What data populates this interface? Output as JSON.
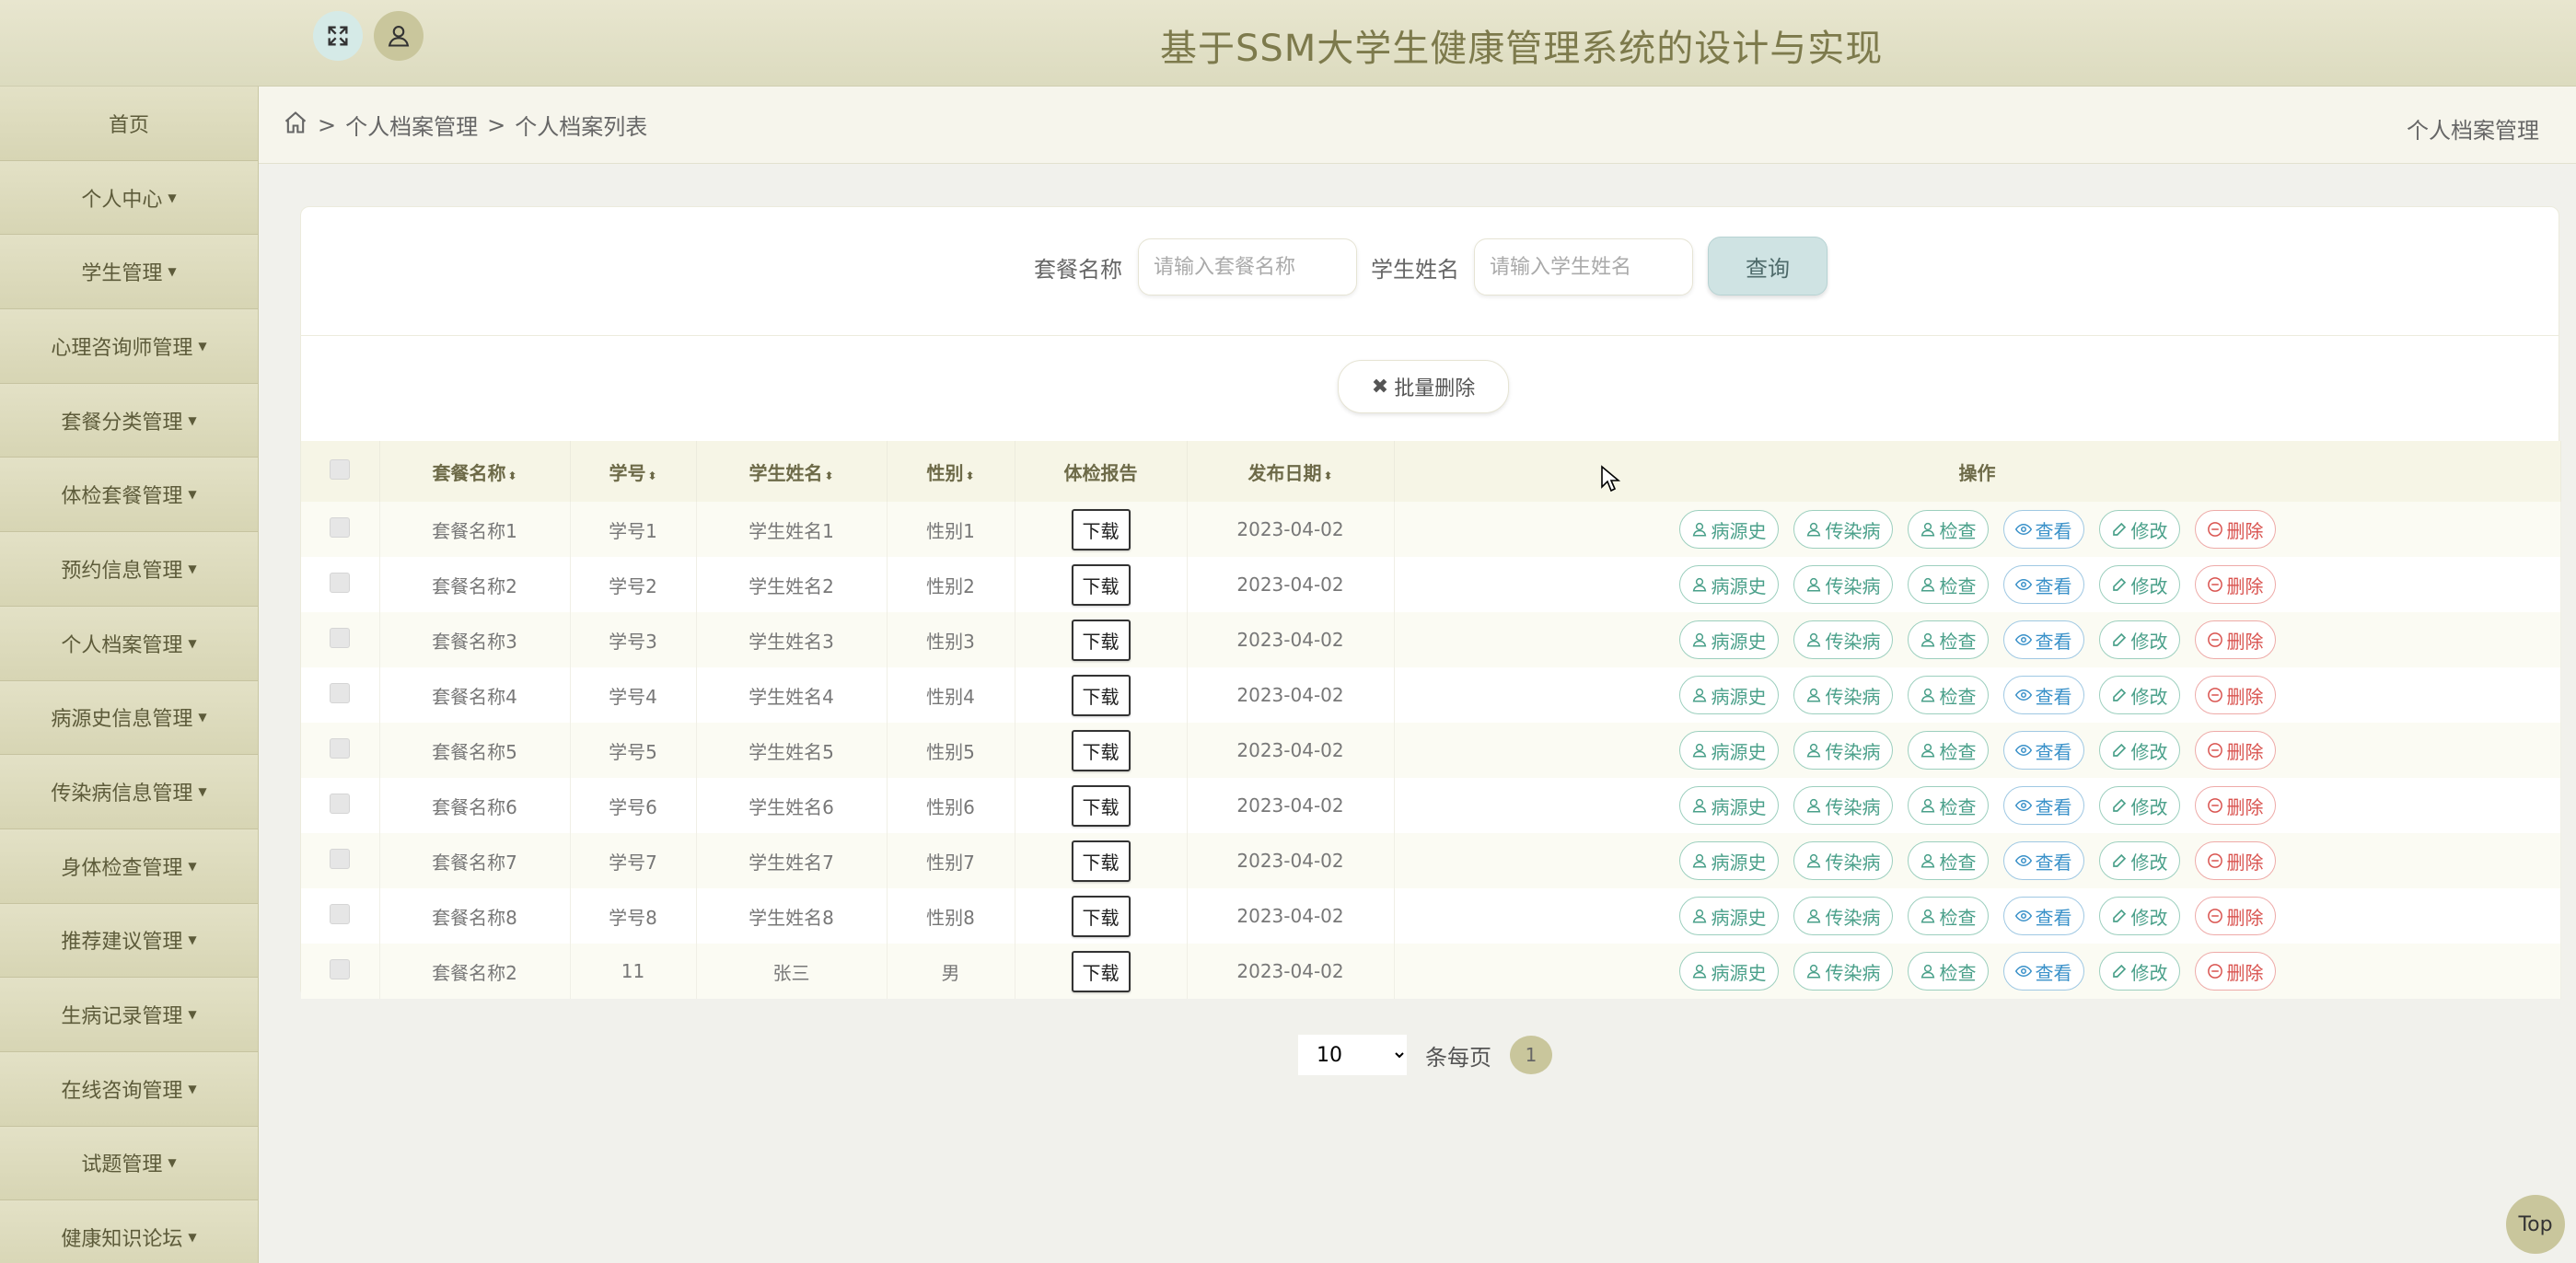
{
  "header": {
    "title": "基于SSM大学生健康管理系统的设计与实现"
  },
  "sidebar": {
    "items": [
      {
        "label": "首页",
        "has_caret": false
      },
      {
        "label": "个人中心",
        "has_caret": true
      },
      {
        "label": "学生管理",
        "has_caret": true
      },
      {
        "label": "心理咨询师管理",
        "has_caret": true
      },
      {
        "label": "套餐分类管理",
        "has_caret": true
      },
      {
        "label": "体检套餐管理",
        "has_caret": true
      },
      {
        "label": "预约信息管理",
        "has_caret": true
      },
      {
        "label": "个人档案管理",
        "has_caret": true
      },
      {
        "label": "病源史信息管理",
        "has_caret": true
      },
      {
        "label": "传染病信息管理",
        "has_caret": true
      },
      {
        "label": "身体检查管理",
        "has_caret": true
      },
      {
        "label": "推荐建议管理",
        "has_caret": true
      },
      {
        "label": "生病记录管理",
        "has_caret": true
      },
      {
        "label": "在线咨询管理",
        "has_caret": true
      },
      {
        "label": "试题管理",
        "has_caret": true
      },
      {
        "label": "健康知识论坛",
        "has_caret": true
      }
    ]
  },
  "breadcrumb": {
    "sep": ">",
    "level1": "个人档案管理",
    "level2": "个人档案列表",
    "right_title": "个人档案管理"
  },
  "search": {
    "package_label": "套餐名称",
    "package_placeholder": "请输入套餐名称",
    "student_label": "学生姓名",
    "student_placeholder": "请输入学生姓名",
    "query_label": "查询"
  },
  "batch_delete_label": "批量删除",
  "table": {
    "headers": {
      "package": "套餐名称",
      "student_no": "学号",
      "student_name": "学生姓名",
      "gender": "性别",
      "report": "体检报告",
      "date": "发布日期",
      "ops": "操作"
    },
    "download_label": "下载",
    "op_labels": [
      "病源史",
      "传染病",
      "检查",
      "查看",
      "修改",
      "删除"
    ],
    "rows": [
      [
        "套餐名称1",
        "学号1",
        "学生姓名1",
        "性别1",
        "2023-04-02"
      ],
      [
        "套餐名称2",
        "学号2",
        "学生姓名2",
        "性别2",
        "2023-04-02"
      ],
      [
        "套餐名称3",
        "学号3",
        "学生姓名3",
        "性别3",
        "2023-04-02"
      ],
      [
        "套餐名称4",
        "学号4",
        "学生姓名4",
        "性别4",
        "2023-04-02"
      ],
      [
        "套餐名称5",
        "学号5",
        "学生姓名5",
        "性别5",
        "2023-04-02"
      ],
      [
        "套餐名称6",
        "学号6",
        "学生姓名6",
        "性别6",
        "2023-04-02"
      ],
      [
        "套餐名称7",
        "学号7",
        "学生姓名7",
        "性别7",
        "2023-04-02"
      ],
      [
        "套餐名称8",
        "学号8",
        "学生姓名8",
        "性别8",
        "2023-04-02"
      ],
      [
        "套餐名称2",
        "11",
        "张三",
        "男",
        "2023-04-02"
      ]
    ]
  },
  "pagination": {
    "page_size": "10",
    "per_page_label": "条每页",
    "current_page": "1"
  },
  "top_button": "Top",
  "colors": {
    "header_bg": "#dcdbbf",
    "sidebar_bg": "#dcdab9",
    "title": "#7d7a4c",
    "accent": "#c9c69c",
    "op_green": "#4aa08a",
    "op_blue": "#3a91c9",
    "op_red": "#d9534f"
  }
}
